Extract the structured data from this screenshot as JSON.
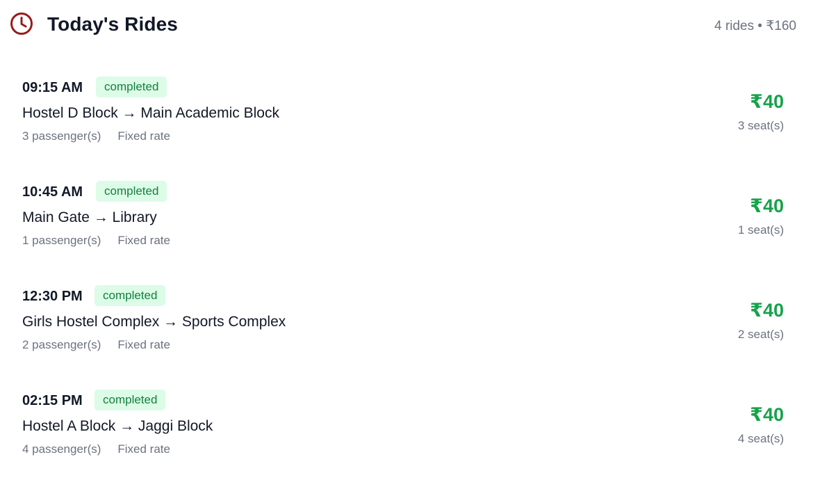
{
  "header": {
    "title": "Today's Rides",
    "summary": "4 rides • ₹160",
    "icon": "clock-icon",
    "icon_color": "#991b1b"
  },
  "colors": {
    "status_text": "#15803d",
    "status_bg": "#dcfce7",
    "price": "#16a34a",
    "muted": "#6b7280"
  },
  "rides": [
    {
      "time": "09:15 AM",
      "status": "completed",
      "route": "Hostel D Block → Main Academic Block",
      "passengers": "3 passenger(s)",
      "rate": "Fixed rate",
      "price": "₹40",
      "seats": "3 seat(s)"
    },
    {
      "time": "10:45 AM",
      "status": "completed",
      "route": "Main Gate → Library",
      "passengers": "1 passenger(s)",
      "rate": "Fixed rate",
      "price": "₹40",
      "seats": "1 seat(s)"
    },
    {
      "time": "12:30 PM",
      "status": "completed",
      "route": "Girls Hostel Complex → Sports Complex",
      "passengers": "2 passenger(s)",
      "rate": "Fixed rate",
      "price": "₹40",
      "seats": "2 seat(s)"
    },
    {
      "time": "02:15 PM",
      "status": "completed",
      "route": "Hostel A Block → Jaggi Block",
      "passengers": "4 passenger(s)",
      "rate": "Fixed rate",
      "price": "₹40",
      "seats": "4 seat(s)"
    }
  ]
}
